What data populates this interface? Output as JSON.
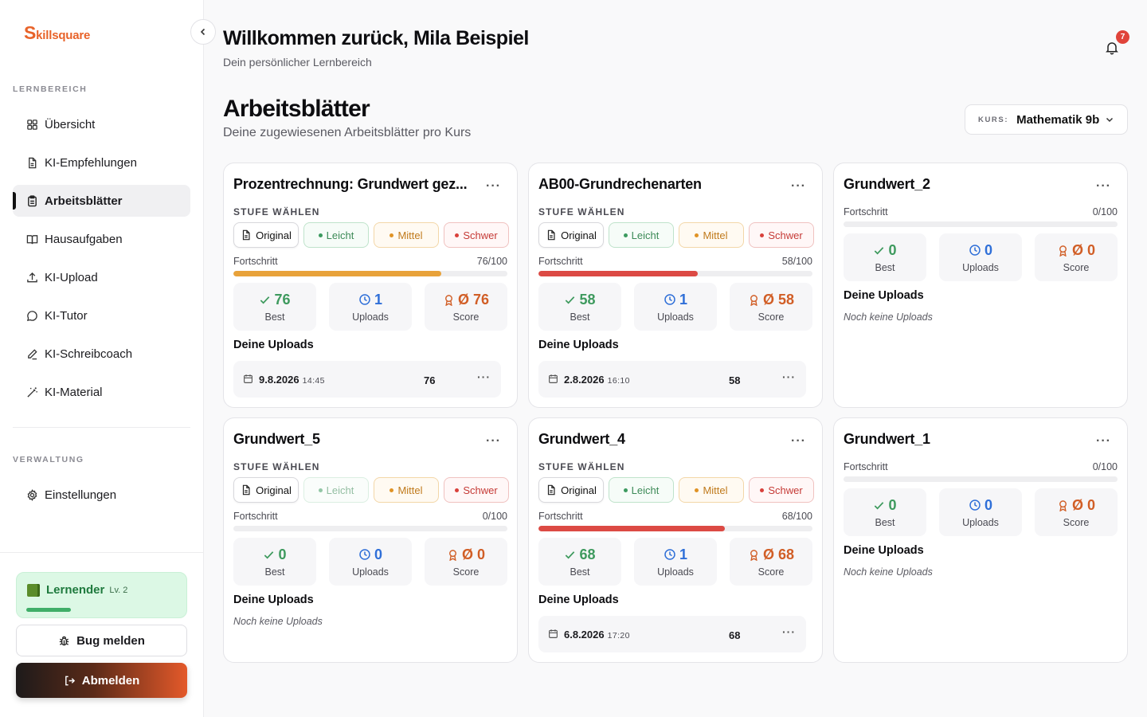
{
  "brand": {
    "initial": "S",
    "rest": "killsquare"
  },
  "nav": {
    "section_learning": "LERNBEREICH",
    "items": [
      {
        "label": "Übersicht",
        "icon": "grid-icon"
      },
      {
        "label": "KI-Empfehlungen",
        "icon": "file-icon"
      },
      {
        "label": "Arbeitsblätter",
        "icon": "clipboard-icon",
        "active": true
      },
      {
        "label": "Hausaufgaben",
        "icon": "book-open-icon"
      },
      {
        "label": "KI-Upload",
        "icon": "upload-icon"
      },
      {
        "label": "KI-Tutor",
        "icon": "chat-icon"
      },
      {
        "label": "KI-Schreibcoach",
        "icon": "pen-icon"
      },
      {
        "label": "KI-Material",
        "icon": "wand-icon"
      }
    ],
    "section_admin": "VERWALTUNG",
    "settings": "Einstellungen"
  },
  "user_level": {
    "role": "Lernender",
    "level": "Lv. 2",
    "progress": 0.26
  },
  "bug_button": "Bug melden",
  "logout_button": "Abmelden",
  "header": {
    "welcome": "Willkommen zurück, Mila Beispiel",
    "subtitle": "Dein persönlicher Lernbereich",
    "notifications": "7"
  },
  "page": {
    "title": "Arbeitsblätter",
    "subtitle": "Deine zugewiesenen Arbeitsblätter pro Kurs",
    "course_key": "KURS:",
    "course_value": "Mathematik 9b"
  },
  "labels": {
    "stufe": "STUFE WÄHLEN",
    "original": "Original",
    "leicht": "Leicht",
    "mittel": "Mittel",
    "schwer": "Schwer",
    "fortschritt": "Fortschritt",
    "best": "Best",
    "uploads": "Uploads",
    "score": "Score",
    "deine_uploads": "Deine Uploads",
    "no_uploads": "Noch keine Uploads"
  },
  "colors": {
    "accent": "#e8632a",
    "progress_orange": "#e8a23a",
    "progress_red": "#dc4a44"
  },
  "cards": [
    {
      "title": "Prozentrechnung: Grundwert gez...",
      "progress": "76/100",
      "best": "76",
      "uploads": "1",
      "score": "Ø 76",
      "upload_date": "9.8.2026",
      "upload_time": "14:45",
      "upload_score": "76"
    },
    {
      "title": "AB00-Grundrechenarten",
      "progress": "58/100",
      "best": "58",
      "uploads": "1",
      "score": "Ø 58",
      "upload_date": "2.8.2026",
      "upload_time": "16:10",
      "upload_score": "58"
    },
    {
      "title": "Grundwert_2",
      "progress": "0/100",
      "best": "0",
      "uploads": "0",
      "score": "Ø 0"
    },
    {
      "title": "Grundwert_5",
      "progress": "0/100",
      "best": "0",
      "uploads": "0",
      "score": "Ø 0"
    },
    {
      "title": "Grundwert_4",
      "progress": "68/100",
      "best": "68",
      "uploads": "1",
      "score": "Ø 68",
      "upload_date": "6.8.2026",
      "upload_time": "17:20",
      "upload_score": "68"
    },
    {
      "title": "Grundwert_1",
      "progress": "0/100",
      "best": "0",
      "uploads": "0",
      "score": "Ø 0"
    }
  ],
  "more_glyph": "···"
}
